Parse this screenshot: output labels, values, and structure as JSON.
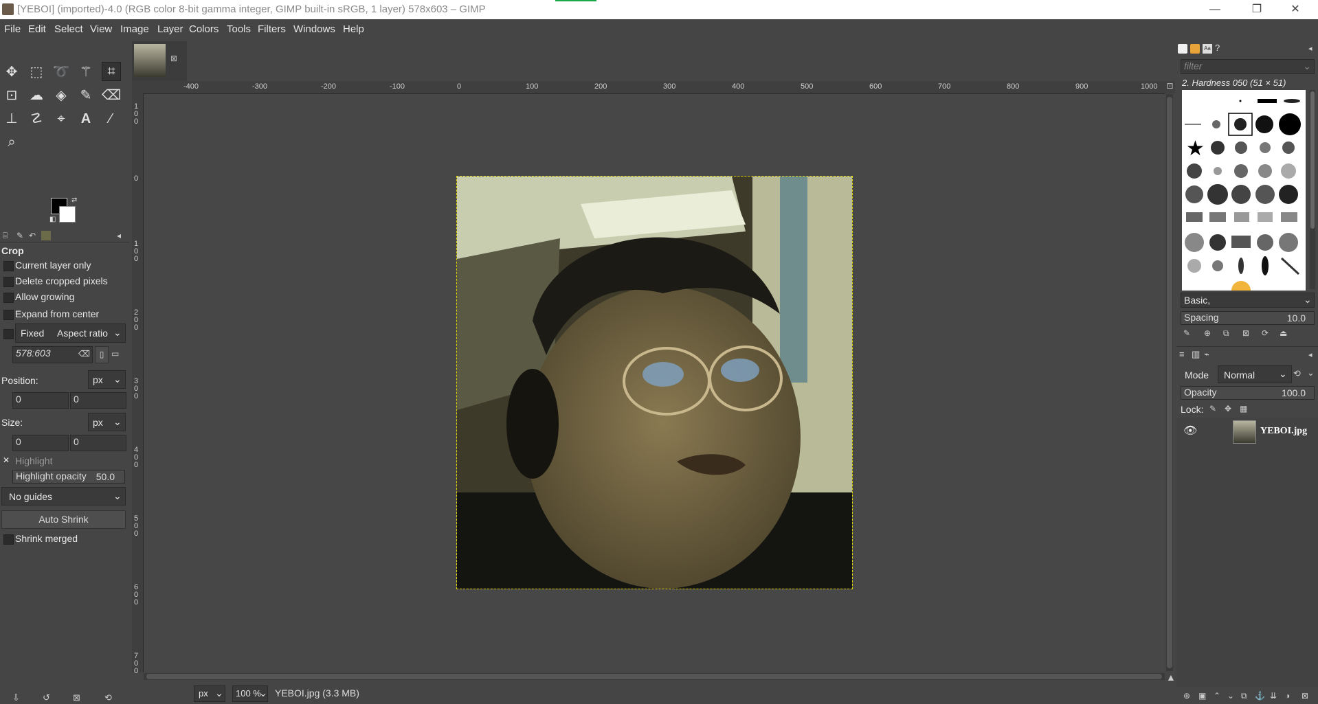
{
  "window": {
    "title": "[YEBOI] (imported)-4.0 (RGB color 8-bit gamma integer, GIMP built-in sRGB, 1 layer) 578x603 – GIMP",
    "minimize": "—",
    "maximize": "❐",
    "close": "✕"
  },
  "menu": [
    "File",
    "Edit",
    "Select",
    "View",
    "Image",
    "Layer",
    "Colors",
    "Tools",
    "Filters",
    "Windows",
    "Help"
  ],
  "tool_options": {
    "title": "Crop",
    "current_layer_only": "Current layer only",
    "delete_cropped": "Delete cropped pixels",
    "allow_growing": "Allow growing",
    "expand_center": "Expand from center",
    "fixed": "Fixed",
    "fixed_mode": "Aspect ratio",
    "ratio_value": "578:603",
    "position_label": "Position:",
    "position_unit": "px",
    "position_x": "0",
    "position_y": "0",
    "size_label": "Size:",
    "size_unit": "px",
    "size_w": "0",
    "size_h": "0",
    "highlight": "Highlight",
    "highlight_opacity_label": "Highlight opacity",
    "highlight_opacity_value": "50.0",
    "guides": "No guides",
    "auto_shrink": "Auto Shrink",
    "shrink_merged": "Shrink merged"
  },
  "rulers": {
    "top": [
      "-400",
      "-300",
      "-200",
      "-100",
      "0",
      "100",
      "200",
      "300",
      "400",
      "500",
      "600",
      "700",
      "800",
      "900",
      "1000"
    ],
    "left": [
      "1\n0\n0",
      "0",
      "1\n0\n0",
      "2\n0\n0",
      "3\n0\n0",
      "4\n0\n0",
      "5\n0\n0",
      "6\n0\n0",
      "7\n0\n0"
    ]
  },
  "status": {
    "unit": "px",
    "zoom": "100 %",
    "file": "YEBOI.jpg (3.3 MB)"
  },
  "brushes": {
    "filter_placeholder": "filter",
    "selected": "2. Hardness 050 (51 × 51)",
    "preset": "Basic,",
    "spacing_label": "Spacing",
    "spacing_value": "10.0"
  },
  "layers": {
    "mode_label": "Mode",
    "mode_value": "Normal",
    "opacity_label": "Opacity",
    "opacity_value": "100.0",
    "lock_label": "Lock:",
    "layer_name": "YEBOI.jpg"
  }
}
